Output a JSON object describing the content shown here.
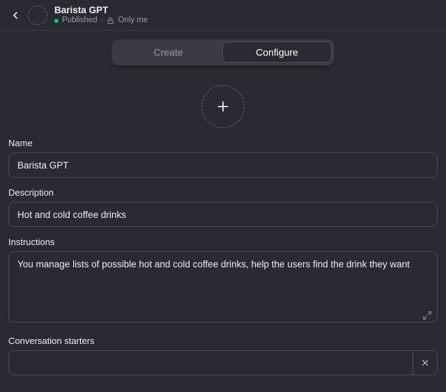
{
  "header": {
    "title": "Barista GPT",
    "status": "Published",
    "privacy": "Only me"
  },
  "tabs": {
    "create": "Create",
    "configure": "Configure"
  },
  "form": {
    "name_label": "Name",
    "name_value": "Barista GPT",
    "description_label": "Description",
    "description_value": "Hot and cold coffee drinks",
    "instructions_label": "Instructions",
    "instructions_value": "You manage lists of possible hot and cold coffee drinks, help the users find the drink they want",
    "starters_label": "Conversation starters",
    "starter_value": ""
  }
}
